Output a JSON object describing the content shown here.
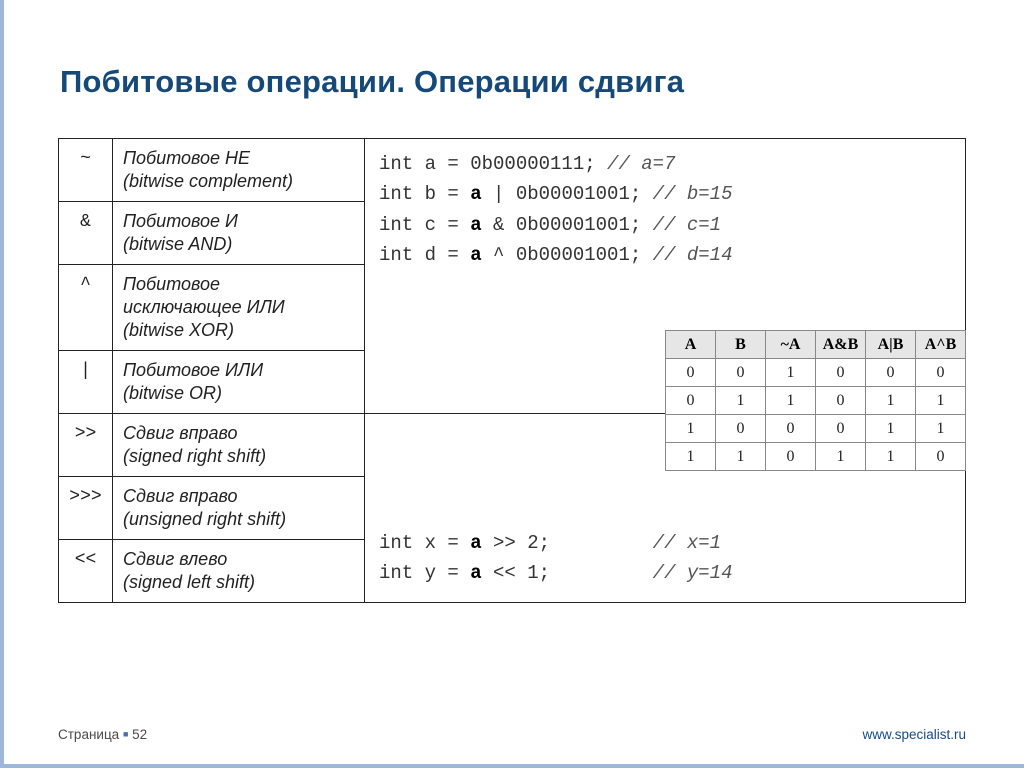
{
  "title": "Побитовые операции. Операции сдвига",
  "ops": [
    {
      "sym": "~",
      "desc": "Побитовое НЕ\n(bitwise complement)"
    },
    {
      "sym": "&",
      "desc": "Побитовое И\n(bitwise AND)"
    },
    {
      "sym": "^",
      "desc": "Побитовое\nисключающее ИЛИ\n(bitwise XOR)"
    },
    {
      "sym": "|",
      "desc": "Побитовое ИЛИ\n(bitwise OR)"
    },
    {
      "sym": ">>",
      "desc": "Сдвиг вправо\n(signed right shift)"
    },
    {
      "sym": ">>>",
      "desc": "Сдвиг вправо\n(unsigned right shift)"
    },
    {
      "sym": "<<",
      "desc": "Сдвиг влево\n(signed left shift)"
    }
  ],
  "code1": {
    "l1a": "int a =     0b00000111;",
    "l1c": "// a=7",
    "l2a": "int b = ",
    "l2b": "a",
    "l2r": " | 0b00001001;",
    "l2c": "// b=15",
    "l3a": "int c = ",
    "l3b": "a",
    "l3r": " & 0b00001001;",
    "l3c": "// c=1",
    "l4a": "int d = ",
    "l4b": "a",
    "l4r": " ^ 0b00001001;",
    "l4c": "// d=14"
  },
  "code2": {
    "l1a": "int x = ",
    "l1b": "a",
    "l1r": " >> 2;",
    "l1pad": "         ",
    "l1c": "// x=1",
    "l2a": "int y = ",
    "l2b": "a",
    "l2r": " << 1;",
    "l2pad": "         ",
    "l2c": "// y=14"
  },
  "truth": {
    "head": [
      "A",
      "B",
      "~A",
      "A&B",
      "A|B",
      "A^B"
    ],
    "rows": [
      [
        "0",
        "0",
        "1",
        "0",
        "0",
        "0"
      ],
      [
        "0",
        "1",
        "1",
        "0",
        "1",
        "1"
      ],
      [
        "1",
        "0",
        "0",
        "0",
        "1",
        "1"
      ],
      [
        "1",
        "1",
        "0",
        "1",
        "1",
        "0"
      ]
    ]
  },
  "footer": {
    "page_label": "Страница",
    "page_num": "52",
    "url": "www.specialist.ru"
  },
  "chart_data": {
    "type": "table",
    "title": "Bitwise truth table",
    "columns": [
      "A",
      "B",
      "~A",
      "A&B",
      "A|B",
      "A^B"
    ],
    "rows": [
      [
        0,
        0,
        1,
        0,
        0,
        0
      ],
      [
        0,
        1,
        1,
        0,
        1,
        1
      ],
      [
        1,
        0,
        0,
        0,
        1,
        1
      ],
      [
        1,
        1,
        0,
        1,
        1,
        0
      ]
    ]
  }
}
